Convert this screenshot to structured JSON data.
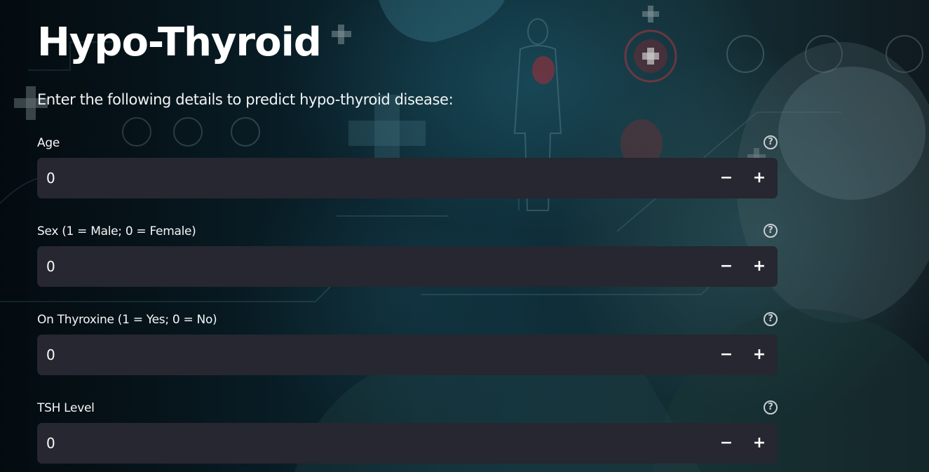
{
  "page": {
    "title": "Hypo-Thyroid",
    "subtitle": "Enter the following details to predict hypo-thyroid disease:"
  },
  "fields": [
    {
      "label": "Age",
      "value": "0"
    },
    {
      "label": "Sex (1 = Male; 0 = Female)",
      "value": "0"
    },
    {
      "label": "On Thyroxine (1 = Yes; 0 = No)",
      "value": "0"
    },
    {
      "label": "TSH Level",
      "value": "0"
    }
  ],
  "controls": {
    "help_glyph": "?",
    "minus_glyph": "−",
    "plus_glyph": "+"
  },
  "icons": {
    "help": "question-circle-icon",
    "minus": "minus-icon",
    "plus": "plus-icon"
  },
  "colors": {
    "input_background": "#262730",
    "text": "#ffffff",
    "background_tint": "#0f3340"
  }
}
